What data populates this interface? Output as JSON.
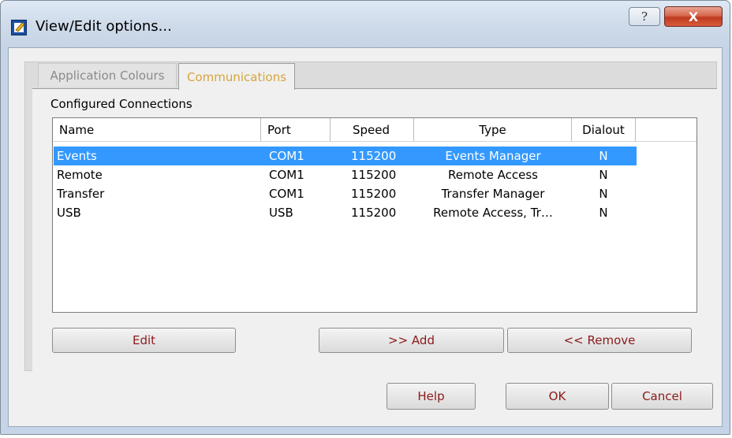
{
  "window": {
    "title": "View/Edit options...",
    "help_glyph": "?",
    "close_glyph": "X"
  },
  "tabs": [
    {
      "label": "Application Colours",
      "active": false
    },
    {
      "label": "Communications",
      "active": true
    }
  ],
  "connections": {
    "group_label": "Configured Connections",
    "columns": [
      "Name",
      "Port",
      "Speed",
      "Type",
      "Dialout"
    ],
    "rows": [
      {
        "name": "Events",
        "port": "COM1",
        "speed": "115200",
        "type": "Events Manager",
        "dialout": "N",
        "selected": true
      },
      {
        "name": "Remote",
        "port": "COM1",
        "speed": "115200",
        "type": "Remote Access",
        "dialout": "N",
        "selected": false
      },
      {
        "name": "Transfer",
        "port": "COM1",
        "speed": "115200",
        "type": "Transfer Manager",
        "dialout": "N",
        "selected": false
      },
      {
        "name": "USB",
        "port": "USB",
        "speed": "115200",
        "type": "Remote Access, Tr…",
        "dialout": "N",
        "selected": false
      }
    ]
  },
  "actions": {
    "edit": "Edit",
    "add": ">> Add",
    "remove": "<< Remove"
  },
  "dialog_buttons": {
    "help": "Help",
    "ok": "OK",
    "cancel": "Cancel"
  },
  "colors": {
    "selection": "#3399ff",
    "active_tab_text": "#d6a53a",
    "button_text": "#8b1a1a",
    "close_button": "#c8442a"
  }
}
